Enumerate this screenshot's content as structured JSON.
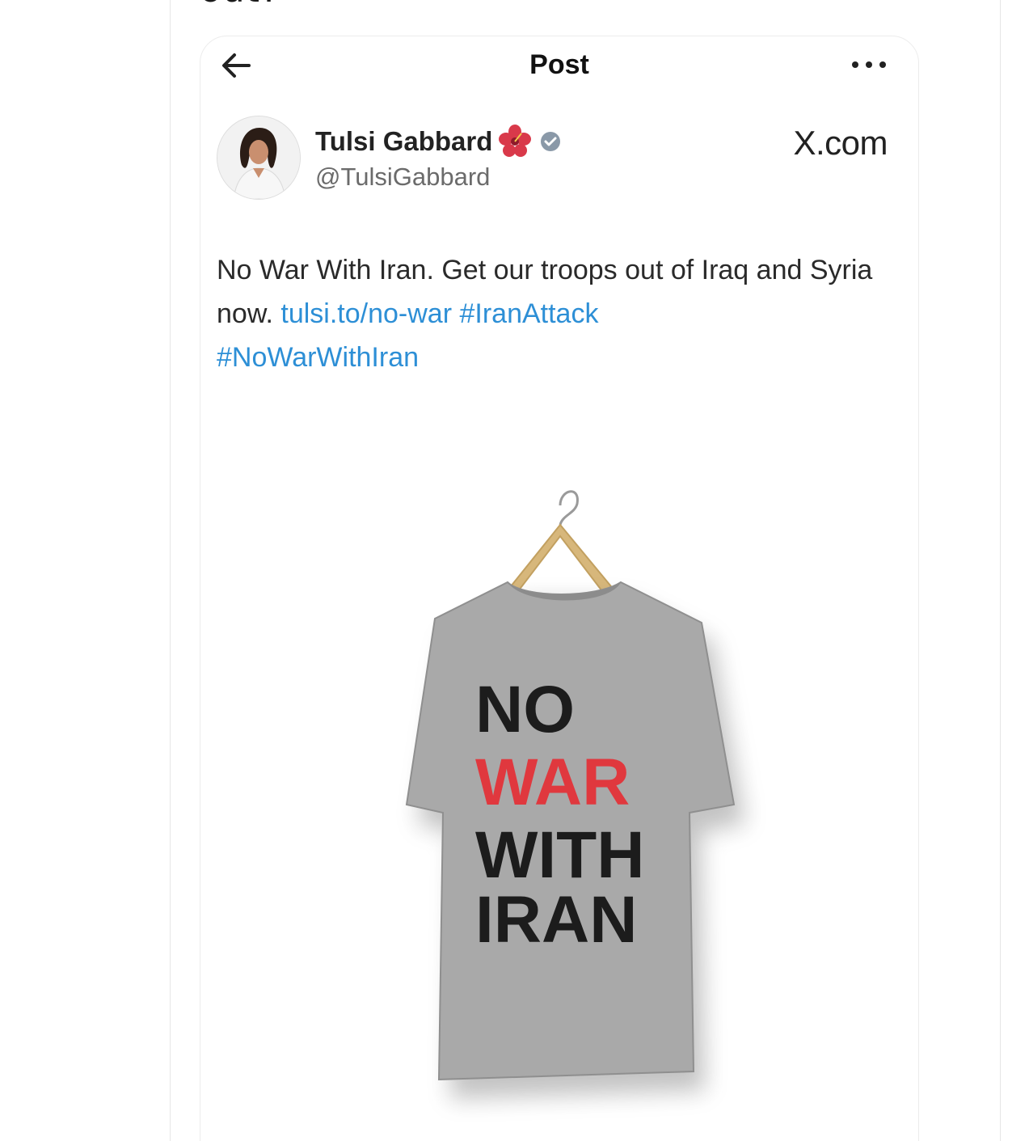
{
  "page": {
    "cut_heading_fragment": "out?"
  },
  "header": {
    "title": "Post",
    "back_icon": "arrow-left-icon",
    "more_icon": "more-horizontal-icon"
  },
  "author": {
    "display_name": "Tulsi Gabbard",
    "handle": "@TulsiGabbard",
    "emoji_icon": "hibiscus-icon",
    "verified_icon": "verified-badge-icon"
  },
  "source_label": "X.com",
  "post": {
    "text_part1": "No War With Iran. Get our troops out of Iraq and Syria now. ",
    "link_url_text": "tulsi.to/no-war",
    "space": " ",
    "hashtag_1": "#IranAttack",
    "hashtag_2": "#NoWarWithIran"
  },
  "media": {
    "shirt_text_line1": "NO",
    "shirt_text_line2": "WAR",
    "shirt_text_line3": "WITH",
    "shirt_text_line4": "IRAN"
  },
  "colors": {
    "link": "#2d8fd6",
    "shirt": "#a9a9a9",
    "shirt_red": "#e0383e",
    "hanger": "#d7b77b"
  }
}
